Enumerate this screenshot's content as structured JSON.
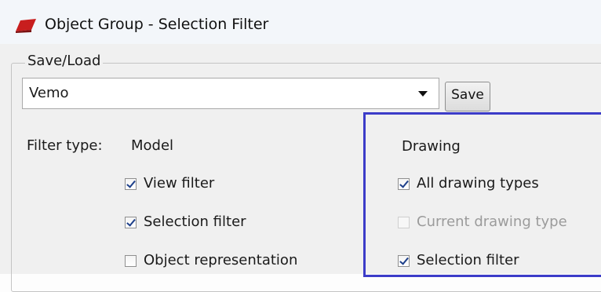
{
  "window": {
    "title": "Object Group - Selection Filter",
    "icon": "app-icon"
  },
  "saveload": {
    "legend": "Save/Load",
    "combo_value": "Vemo",
    "save_label": "Save"
  },
  "filter": {
    "label": "Filter type:",
    "model_heading": "Model",
    "drawing_heading": "Drawing",
    "model_items": [
      {
        "label": "View filter",
        "checked": true
      },
      {
        "label": "Selection filter",
        "checked": true
      },
      {
        "label": "Object representation",
        "checked": false
      }
    ],
    "drawing_items": [
      {
        "label": "All drawing types",
        "checked": true,
        "enabled": true
      },
      {
        "label": "Current drawing type",
        "checked": false,
        "enabled": false
      },
      {
        "label": "Selection filter",
        "checked": true,
        "enabled": true
      }
    ]
  },
  "colors": {
    "highlight_border": "#3c3cc8",
    "icon_red": "#c81e1e"
  }
}
